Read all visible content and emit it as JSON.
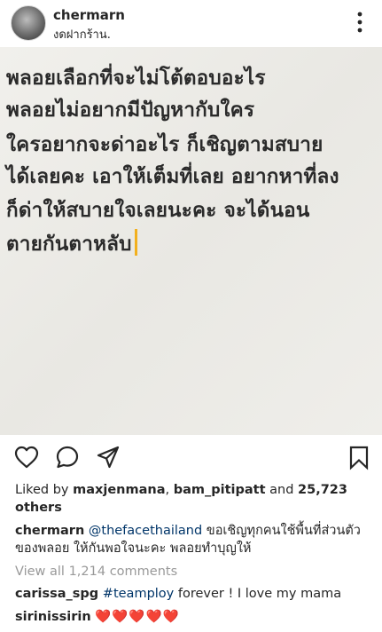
{
  "post": {
    "username": "chermarn",
    "location": "งดฝากร้าน.",
    "more_icon": "more-vertical-icon"
  },
  "photo": {
    "text_lines": [
      "พลอยเลือกที่จะไม่โต้ตอบอะไร",
      "พลอยไม่อยากมีปัญหากับใคร",
      "ใครอยากจะด่าอะไร ก็เชิญตามสบาย",
      "ได้เลยคะ เอาให้เต็มที่เลย อยากหาที่ลง",
      "ก็ด่าให้สบายใจเลยนะคะ จะได้นอน",
      "ตายกันตาหลับ"
    ],
    "cursor_color": "#f2b01e"
  },
  "actions": {
    "like_icon": "heart-icon",
    "comment_icon": "comment-icon",
    "share_icon": "share-icon",
    "save_icon": "bookmark-icon"
  },
  "likes": {
    "prefix": "Liked by ",
    "user1": "maxjenmana",
    "sep": ", ",
    "user2": "bam_pitipatt",
    "and": " and ",
    "count": "25,723",
    "others": "others"
  },
  "caption": {
    "username": "chermarn",
    "mention": "@thefacethailand",
    "text": " ขอเชิญทุกคนใช้พื้นที่ส่วนตัวของพลอย ให้กันพอใจนะคะ พลอยทำบุญให้"
  },
  "comments": {
    "view_all": "View all 1,214 comments",
    "items": [
      {
        "username": "carissa_spg",
        "hashtag": "#teamploy",
        "text": " forever ! I love my mama"
      },
      {
        "username": "sirinissirin",
        "text": "❤️❤️❤️❤️❤️"
      }
    ]
  },
  "colors": {
    "text": "#262626",
    "link": "#003569",
    "muted": "#999999",
    "heart": "#ed4956"
  }
}
